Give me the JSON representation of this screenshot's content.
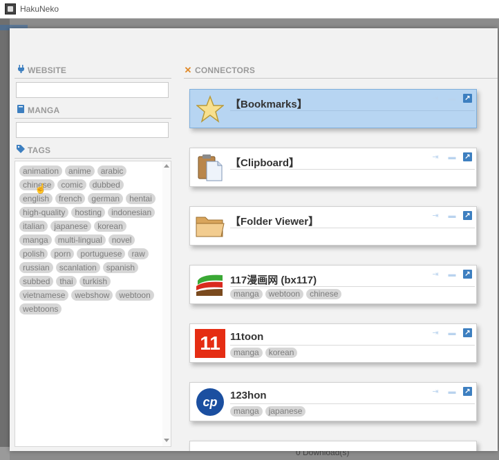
{
  "window": {
    "title": "HakuNeko"
  },
  "background": {
    "footer_text": "0 Download(s)"
  },
  "sidebar": {
    "website_header": "WEBSITE",
    "website_input": "",
    "manga_header": "MANGA",
    "manga_input": "",
    "tags_header": "TAGS",
    "tags": [
      "animation",
      "anime",
      "arabic",
      "chinese",
      "comic",
      "dubbed",
      "english",
      "french",
      "german",
      "hentai",
      "high-quality",
      "hosting",
      "indonesian",
      "italian",
      "japanese",
      "korean",
      "manga",
      "multi-lingual",
      "novel",
      "polish",
      "porn",
      "portuguese",
      "raw",
      "russian",
      "scanlation",
      "spanish",
      "subbed",
      "thai",
      "turkish",
      "vietnamese",
      "webshow",
      "webtoon",
      "webtoons"
    ]
  },
  "connectors": {
    "header": "CONNECTORS",
    "items": [
      {
        "title": "【Bookmarks】",
        "logo": "star-icon",
        "tags": [],
        "selected": true
      },
      {
        "title": "【Clipboard】",
        "logo": "clipboard-icon",
        "tags": []
      },
      {
        "title": "【Folder Viewer】",
        "logo": "folder-icon",
        "tags": []
      },
      {
        "title": "117漫画网 (bx117)",
        "logo": "bx117-logo",
        "tags": [
          "manga",
          "webtoon",
          "chinese"
        ]
      },
      {
        "title": "11toon",
        "logo": "11toon-logo",
        "logo_text": "11",
        "tags": [
          "manga",
          "korean"
        ]
      },
      {
        "title": "123hon",
        "logo": "123hon-logo",
        "logo_text": "cp",
        "tags": [
          "manga",
          "japanese"
        ]
      }
    ]
  },
  "colors": {
    "accent": "#3d7fc0",
    "selected": "#b7d5f2",
    "header_text": "#9a9a9a",
    "tag_bg": "#d6d6d6",
    "close_icon": "#e08a2a"
  }
}
